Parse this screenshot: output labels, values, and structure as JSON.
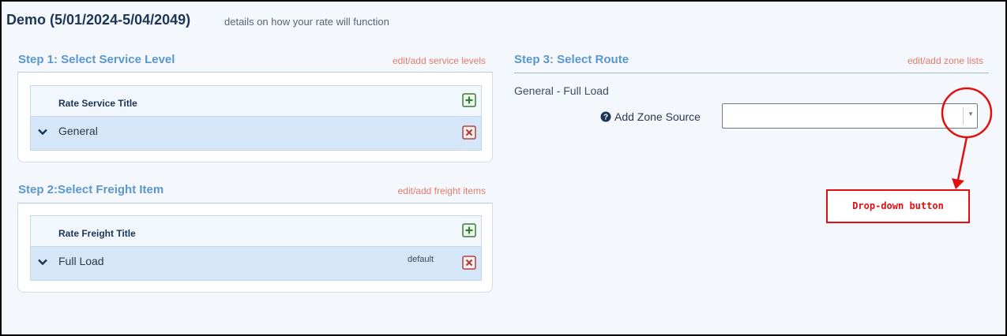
{
  "header": {
    "title": "Demo (5/01/2024-5/04/2049)",
    "subtitle": "details on how your rate will function"
  },
  "step1": {
    "title": "Step 1: Select Service Level",
    "edit_link": "edit/add service levels",
    "table_header": "Rate Service Title",
    "rows": [
      {
        "label": "General"
      }
    ]
  },
  "step2": {
    "title": "Step 2:Select Freight Item",
    "edit_link": "edit/add freight items",
    "table_header": "Rate Freight Title",
    "rows": [
      {
        "label": "Full Load",
        "badge": "default"
      }
    ]
  },
  "step3": {
    "title": "Step 3: Select Route",
    "edit_link": "edit/add zone lists",
    "route_label": "General - Full Load",
    "zone_source_label": "Add Zone Source",
    "zone_source_value": ""
  },
  "annotation": {
    "label": "Drop-down button",
    "color": "#e01010"
  },
  "icons": {
    "add": "plus-square-icon",
    "delete": "x-square-icon",
    "expand": "chevron-down-icon",
    "help": "question-circle-icon"
  },
  "colors": {
    "accent_title": "#5a97cf",
    "link": "#e07c68",
    "row_bg": "#d4e6f8",
    "add_green": "#3a7a3a",
    "delete_red": "#b04040"
  }
}
